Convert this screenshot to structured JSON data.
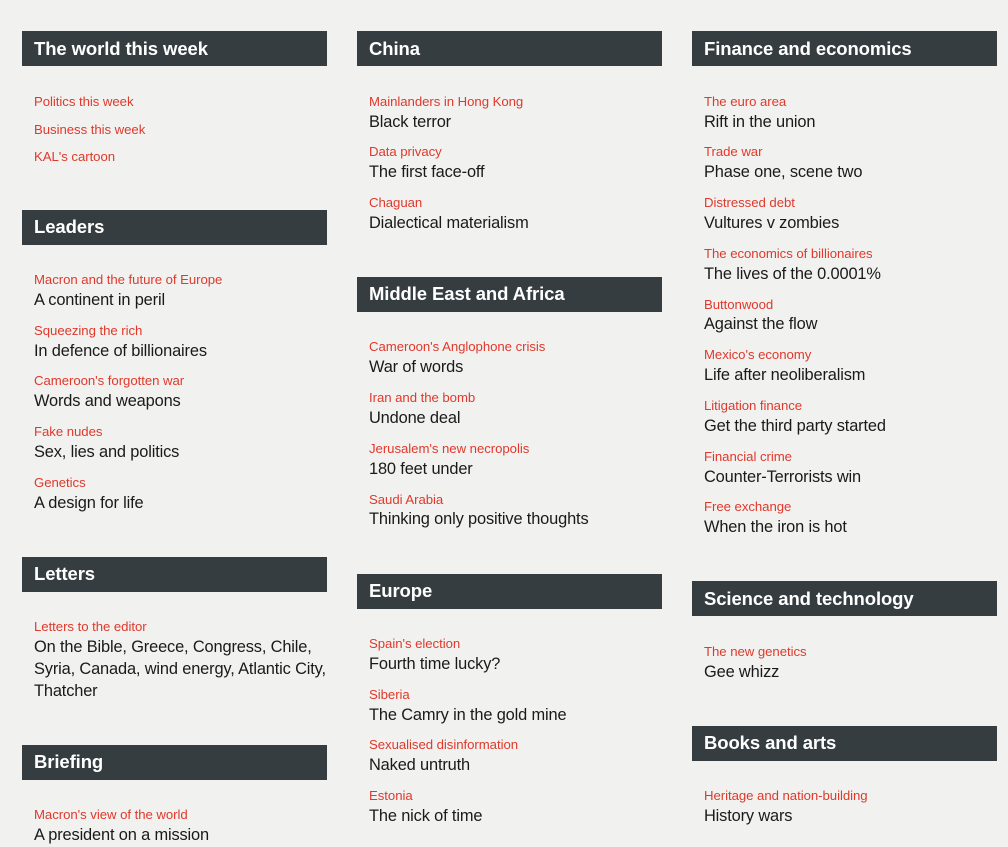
{
  "palette": {
    "background": "#f1f1f0",
    "header_bar": "#353d41",
    "header_text": "#ffffff",
    "flytitle_red": "#e0392c",
    "title_text": "#1a1a1a"
  },
  "columns": [
    {
      "name": "column-left",
      "sections": [
        {
          "header": "The world this week",
          "articles": [
            {
              "flytitle": "Politics this week",
              "title": ""
            },
            {
              "flytitle": "Business this week",
              "title": ""
            },
            {
              "flytitle": "KAL's cartoon",
              "title": ""
            }
          ]
        },
        {
          "header": "Leaders",
          "articles": [
            {
              "flytitle": "Macron and the future of Europe",
              "title": "A continent in peril"
            },
            {
              "flytitle": "Squeezing the rich",
              "title": "In defence of billionaires"
            },
            {
              "flytitle": "Cameroon's forgotten war",
              "title": "Words and weapons"
            },
            {
              "flytitle": "Fake nudes",
              "title": "Sex, lies and politics"
            },
            {
              "flytitle": "Genetics",
              "title": "A design for life"
            }
          ]
        },
        {
          "header": "Letters",
          "articles": [
            {
              "flytitle": "Letters to the editor",
              "title": "On the Bible, Greece, Congress, Chile, Syria, Canada, wind energy, Atlantic City, Thatcher"
            }
          ]
        },
        {
          "header": "Briefing",
          "articles": [
            {
              "flytitle": "Macron's view of the world",
              "title": "A president on a mission"
            }
          ]
        }
      ]
    },
    {
      "name": "column-middle",
      "sections": [
        {
          "header": "China",
          "articles": [
            {
              "flytitle": "Mainlanders in Hong Kong",
              "title": "Black terror"
            },
            {
              "flytitle": "Data privacy",
              "title": "The first face-off"
            },
            {
              "flytitle": "Chaguan",
              "title": "Dialectical materialism"
            }
          ]
        },
        {
          "header": "Middle East and Africa",
          "articles": [
            {
              "flytitle": "Cameroon's Anglophone crisis",
              "title": "War of words"
            },
            {
              "flytitle": "Iran and the bomb",
              "title": "Undone deal"
            },
            {
              "flytitle": "Jerusalem's new necropolis",
              "title": "180 feet under"
            },
            {
              "flytitle": "Saudi Arabia",
              "title": "Thinking only positive thoughts"
            }
          ]
        },
        {
          "header": "Europe",
          "articles": [
            {
              "flytitle": "Spain's election",
              "title": "Fourth time lucky?"
            },
            {
              "flytitle": "Siberia",
              "title": "The Camry in the gold mine"
            },
            {
              "flytitle": "Sexualised disinformation",
              "title": "Naked untruth"
            },
            {
              "flytitle": "Estonia",
              "title": "The nick of time"
            }
          ]
        }
      ]
    },
    {
      "name": "column-right",
      "sections": [
        {
          "header": "Finance and economics",
          "articles": [
            {
              "flytitle": "The euro area",
              "title": "Rift in the union"
            },
            {
              "flytitle": "Trade war",
              "title": "Phase one, scene two"
            },
            {
              "flytitle": "Distressed debt",
              "title": "Vultures v zombies"
            },
            {
              "flytitle": "The economics of billionaires",
              "title": "The lives of the 0.0001%"
            },
            {
              "flytitle": "Buttonwood",
              "title": "Against the flow"
            },
            {
              "flytitle": "Mexico's economy",
              "title": "Life after neoliberalism"
            },
            {
              "flytitle": "Litigation finance",
              "title": "Get the third party started"
            },
            {
              "flytitle": "Financial crime",
              "title": "Counter-Terrorists win"
            },
            {
              "flytitle": "Free exchange",
              "title": "When the iron is hot"
            }
          ]
        },
        {
          "header": "Science and technology",
          "articles": [
            {
              "flytitle": "The new genetics",
              "title": "Gee whizz"
            }
          ]
        },
        {
          "header": "Books and arts",
          "articles": [
            {
              "flytitle": "Heritage and nation-building",
              "title": "History wars"
            }
          ]
        }
      ]
    }
  ]
}
